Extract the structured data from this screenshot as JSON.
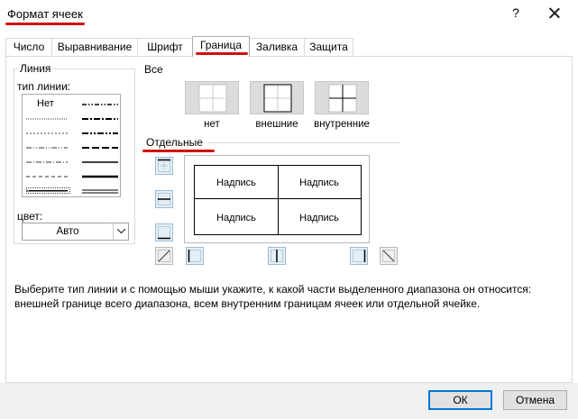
{
  "window": {
    "title": "Формат ячеек",
    "help": "?",
    "close_icon": "close-icon"
  },
  "tabs": [
    {
      "label": "Число"
    },
    {
      "label": "Выравнивание"
    },
    {
      "label": "Шрифт"
    },
    {
      "label": "Граница",
      "active": true
    },
    {
      "label": "Заливка"
    },
    {
      "label": "Защита"
    }
  ],
  "line_group": {
    "title": "Линия",
    "type_label": "тип линии:",
    "none_label": "Нет",
    "color_label": "цвет:",
    "color_value": "Авто"
  },
  "presets": {
    "title": "Все",
    "items": [
      {
        "label": "нет"
      },
      {
        "label": "внешние"
      },
      {
        "label": "внутренние"
      }
    ]
  },
  "individual": {
    "title": "Отдельные",
    "cells": [
      "Надпись",
      "Надпись",
      "Надпись",
      "Надпись"
    ]
  },
  "description": "Выберите тип линии и с помощью мыши укажите, к какой части выделенного диапазона он относится: внешней границе всего диапазона, всем внутренним границам ячеек или отдельной ячейке.",
  "buttons": {
    "ok": "ОК",
    "cancel": "Отмена"
  },
  "colors": {
    "annotation": "#d01010",
    "default_button": "#0078d7",
    "button_highlight": "#e4eef7"
  }
}
